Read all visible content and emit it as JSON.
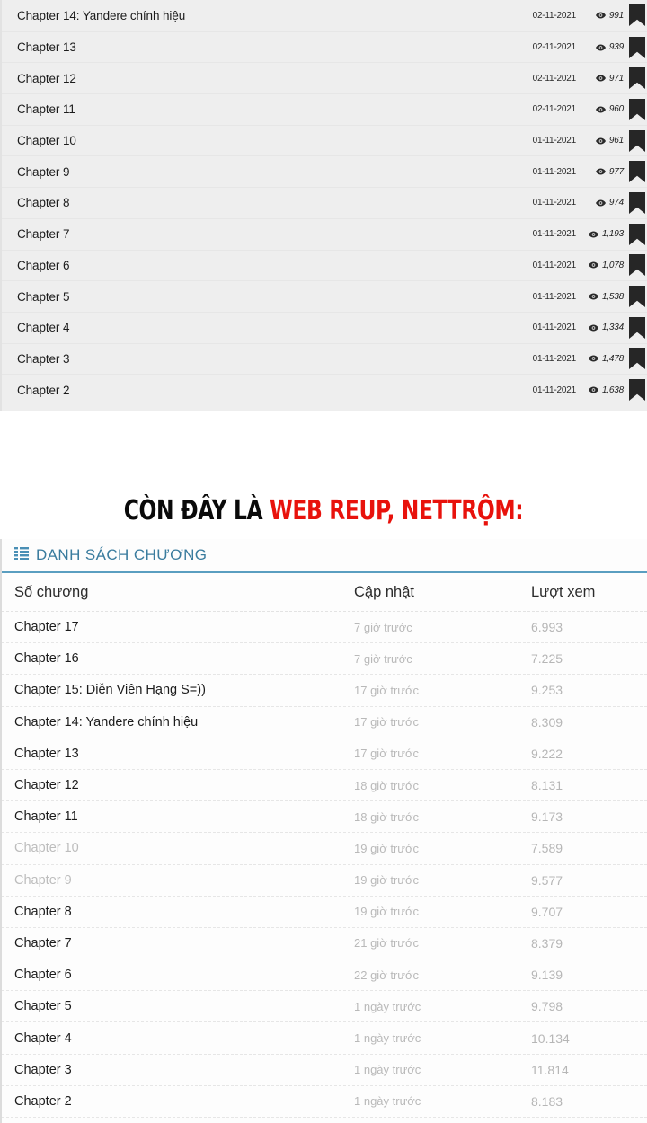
{
  "panel_a": {
    "icons": {
      "views": "eye-icon",
      "bookmark": "bookmark-icon"
    },
    "rows": [
      {
        "title": "Chapter 14: Yandere chính hiệu",
        "date": "02-11-2021",
        "views": "991"
      },
      {
        "title": "Chapter 13",
        "date": "02-11-2021",
        "views": "939"
      },
      {
        "title": "Chapter 12",
        "date": "02-11-2021",
        "views": "971"
      },
      {
        "title": "Chapter 11",
        "date": "02-11-2021",
        "views": "960"
      },
      {
        "title": "Chapter 10",
        "date": "01-11-2021",
        "views": "961"
      },
      {
        "title": "Chapter 9",
        "date": "01-11-2021",
        "views": "977"
      },
      {
        "title": "Chapter 8",
        "date": "01-11-2021",
        "views": "974"
      },
      {
        "title": "Chapter 7",
        "date": "01-11-2021",
        "views": "1,193"
      },
      {
        "title": "Chapter 6",
        "date": "01-11-2021",
        "views": "1,078"
      },
      {
        "title": "Chapter 5",
        "date": "01-11-2021",
        "views": "1,538"
      },
      {
        "title": "Chapter 4",
        "date": "01-11-2021",
        "views": "1,334"
      },
      {
        "title": "Chapter 3",
        "date": "01-11-2021",
        "views": "1,478"
      },
      {
        "title": "Chapter 2",
        "date": "01-11-2021",
        "views": "1,638"
      }
    ]
  },
  "banner": {
    "text_black": "CÒN ĐÂY LÀ ",
    "text_red": "WEB REUP, NETTRỘM:",
    "color_black": "#0a0a0a",
    "color_red": "#e8120c"
  },
  "panel_b": {
    "header": {
      "title": "DANH SÁCH CHƯƠNG",
      "icon": "list-icon",
      "color": "#3a7c9e",
      "underline_color": "#5a9ec0"
    },
    "columns": {
      "chapter": "Số chương",
      "updated": "Cập nhật",
      "views": "Lượt xem"
    },
    "rows": [
      {
        "title": "Chapter 17",
        "updated": "7 giờ trước",
        "views": "6.993",
        "read": false
      },
      {
        "title": "Chapter 16",
        "updated": "7 giờ trước",
        "views": "7.225",
        "read": false
      },
      {
        "title": "Chapter 15: Diễn Viên Hạng S=))",
        "updated": "17 giờ trước",
        "views": "9.253",
        "read": false
      },
      {
        "title": "Chapter 14: Yandere chính hiệu",
        "updated": "17 giờ trước",
        "views": "8.309",
        "read": false
      },
      {
        "title": "Chapter 13",
        "updated": "17 giờ trước",
        "views": "9.222",
        "read": false
      },
      {
        "title": "Chapter 12",
        "updated": "18 giờ trước",
        "views": "8.131",
        "read": false
      },
      {
        "title": "Chapter 11",
        "updated": "18 giờ trước",
        "views": "9.173",
        "read": false
      },
      {
        "title": "Chapter 10",
        "updated": "19 giờ trước",
        "views": "7.589",
        "read": true
      },
      {
        "title": "Chapter 9",
        "updated": "19 giờ trước",
        "views": "9.577",
        "read": true
      },
      {
        "title": "Chapter 8",
        "updated": "19 giờ trước",
        "views": "9.707",
        "read": false
      },
      {
        "title": "Chapter 7",
        "updated": "21 giờ trước",
        "views": "8.379",
        "read": false
      },
      {
        "title": "Chapter 6",
        "updated": "22 giờ trước",
        "views": "9.139",
        "read": false
      },
      {
        "title": "Chapter 5",
        "updated": "1 ngày trước",
        "views": "9.798",
        "read": false
      },
      {
        "title": "Chapter 4",
        "updated": "1 ngày trước",
        "views": "10.134",
        "read": false
      },
      {
        "title": "Chapter 3",
        "updated": "1 ngày trước",
        "views": "11.814",
        "read": false
      },
      {
        "title": "Chapter 2",
        "updated": "1 ngày trước",
        "views": "8.183",
        "read": false
      }
    ]
  }
}
